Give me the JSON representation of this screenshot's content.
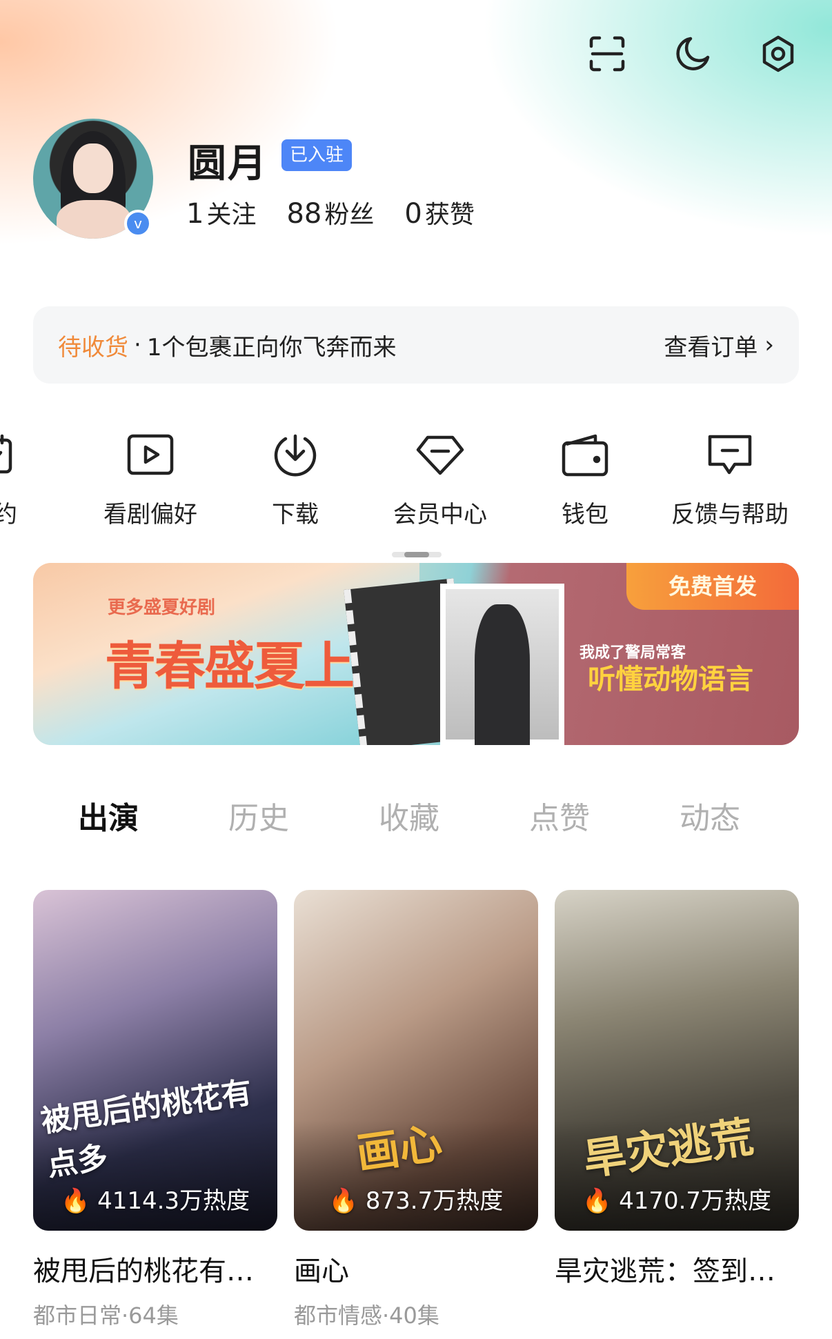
{
  "header": {
    "icons": [
      "scan-icon",
      "moon-icon",
      "settings-icon"
    ]
  },
  "profile": {
    "name": "圆月",
    "badge": "已入驻",
    "verified_mark": "v",
    "stats": [
      {
        "value": "1",
        "label": "关注"
      },
      {
        "value": "88",
        "label": "粉丝"
      },
      {
        "value": "0",
        "label": "获赞"
      }
    ]
  },
  "delivery": {
    "status": "待收货",
    "separator": "·",
    "message": "1个包裹正向你飞奔而来",
    "action": "查看订单",
    "action_arrow": "›"
  },
  "shortcuts": [
    {
      "label": "预约",
      "icon": "calendar-icon"
    },
    {
      "label": "看剧偏好",
      "icon": "play-square-icon"
    },
    {
      "label": "下载",
      "icon": "download-icon"
    },
    {
      "label": "会员中心",
      "icon": "diamond-icon"
    },
    {
      "label": "钱包",
      "icon": "wallet-icon"
    },
    {
      "label": "反馈与帮助",
      "icon": "feedback-icon"
    }
  ],
  "shortcut_scroll_position": 0.5,
  "banner": {
    "subtitle": "更多盛夏好剧",
    "title": "青春盛夏上红果",
    "ribbon": "免费首发",
    "right_subtitle": "我成了警局常客",
    "right_title": "听懂动物语言"
  },
  "tabs": [
    {
      "label": "出演",
      "active": true
    },
    {
      "label": "历史",
      "active": false
    },
    {
      "label": "收藏",
      "active": false
    },
    {
      "label": "点赞",
      "active": false
    },
    {
      "label": "动态",
      "active": false
    }
  ],
  "cards": [
    {
      "title": "被甩后的桃花有…",
      "art": "被甩后的桃花有点多",
      "heat": "4114.3万热度",
      "meta": "都市日常·64集"
    },
    {
      "title": "画心",
      "art": "画心",
      "heat": "873.7万热度",
      "meta": "都市情感·40集"
    },
    {
      "title": "旱灾逃荒：签到…",
      "art": "旱灾逃荒",
      "heat": "4170.7万热度",
      "meta": ""
    }
  ],
  "colors": {
    "accent_orange": "#f08a3a",
    "badge_blue": "#4d86f7",
    "tab_inactive": "#b0b0b0"
  }
}
